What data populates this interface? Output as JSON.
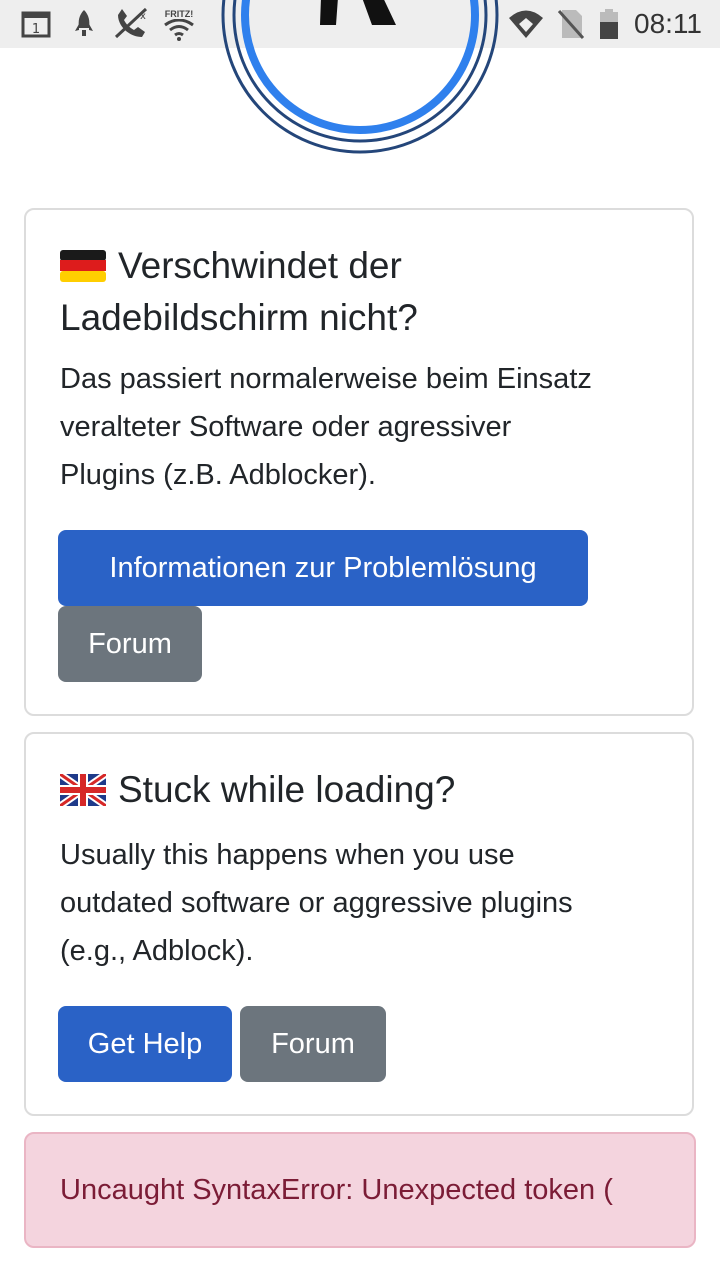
{
  "status_bar": {
    "time": "08:11",
    "icons": [
      "calendar-icon",
      "rocket-icon",
      "no-phone-icon",
      "wifi-fritz-icon",
      "wifi-icon",
      "no-sim-icon",
      "battery-icon"
    ],
    "wifi_label": "FRITZ!"
  },
  "card_de": {
    "title": "Verschwindet der Ladebildschirm nicht?",
    "title_line1": "Verschwindet der",
    "title_line2": "Ladebildschirm nicht?",
    "body_line1": "Das passiert normalerweise beim Einsatz",
    "body_line2": "veralteter Software oder agressiver",
    "body_line3": "Plugins (z.B. Adblocker).",
    "primary_button": "Informationen zur Problemlösung",
    "secondary_button": "Forum"
  },
  "card_en": {
    "title": "Stuck while loading?",
    "body_line1": "Usually this happens when you use",
    "body_line2": "outdated software or aggressive plugins",
    "body_line3": "(e.g., Adblock).",
    "primary_button": "Get Help",
    "secondary_button": "Forum"
  },
  "alert": {
    "message": "Uncaught SyntaxError: Unexpected token ("
  },
  "colors": {
    "primary": "#2a62c6",
    "secondary": "#6c757d",
    "alert_bg": "#f4d4de",
    "alert_text": "#7b1c36",
    "logo_ring": "#2f80ed"
  }
}
